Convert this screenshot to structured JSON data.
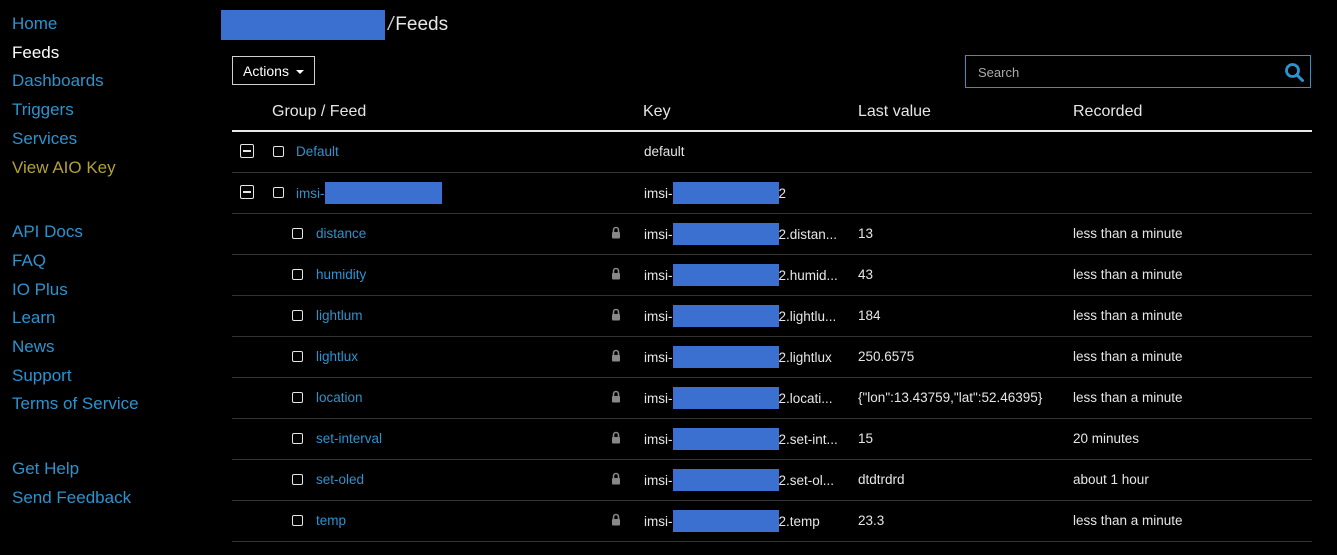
{
  "sidebar": {
    "primary": [
      {
        "label": "Home",
        "name": "sidebar-item-home"
      },
      {
        "label": "Feeds",
        "name": "sidebar-item-feeds"
      },
      {
        "label": "Dashboards",
        "name": "sidebar-item-dashboards"
      },
      {
        "label": "Triggers",
        "name": "sidebar-item-triggers"
      },
      {
        "label": "Services",
        "name": "sidebar-item-services"
      },
      {
        "label": "View AIO Key",
        "name": "sidebar-item-view-aio-key"
      }
    ],
    "secondary": [
      {
        "label": "API Docs"
      },
      {
        "label": "FAQ"
      },
      {
        "label": "IO Plus"
      },
      {
        "label": "Learn"
      },
      {
        "label": "News"
      },
      {
        "label": "Support"
      },
      {
        "label": "Terms of Service"
      }
    ],
    "tertiary": [
      {
        "label": "Get Help"
      },
      {
        "label": "Send Feedback"
      }
    ]
  },
  "breadcrumb": {
    "separator": "/",
    "current": "Feeds"
  },
  "toolbar": {
    "actions_label": "Actions",
    "search_placeholder": "Search"
  },
  "table": {
    "headers": {
      "group_feed": "Group / Feed",
      "key": "Key",
      "last_value": "Last value",
      "recorded": "Recorded"
    },
    "groups": [
      {
        "name": "Default",
        "key": "default"
      },
      {
        "name_prefix": "imsi-",
        "key_prefix": "imsi-",
        "key_suffix": "2"
      }
    ],
    "feeds": [
      {
        "name": "distance",
        "key_prefix": "imsi-",
        "key_suffix": "2.distan...",
        "last_value": "13",
        "recorded": "less than a minute"
      },
      {
        "name": "humidity",
        "key_prefix": "imsi-",
        "key_suffix": "2.humid...",
        "last_value": "43",
        "recorded": "less than a minute"
      },
      {
        "name": "lightlum",
        "key_prefix": "imsi-",
        "key_suffix": "2.lightlu...",
        "last_value": "184",
        "recorded": "less than a minute"
      },
      {
        "name": "lightlux",
        "key_prefix": "imsi-",
        "key_suffix": "2.lightlux",
        "last_value": "250.6575",
        "recorded": "less than a minute"
      },
      {
        "name": "location",
        "key_prefix": "imsi-",
        "key_suffix": "2.locati...",
        "last_value": "{\"lon\":13.43759,\"lat\":52.46395}",
        "recorded": "less than a minute"
      },
      {
        "name": "set-interval",
        "key_prefix": "imsi-",
        "key_suffix": "2.set-int...",
        "last_value": "15",
        "recorded": "20 minutes"
      },
      {
        "name": "set-oled",
        "key_prefix": "imsi-",
        "key_suffix": "2.set-ol...",
        "last_value": "dtdtrdrd",
        "recorded": "about 1 hour"
      },
      {
        "name": "temp",
        "key_prefix": "imsi-",
        "key_suffix": "2.temp",
        "last_value": "23.3",
        "recorded": "less than a minute"
      }
    ]
  },
  "colors": {
    "link": "#2c93cf",
    "aio_key": "#b2a233",
    "redaction": "#3b6fd0",
    "background": "#000000"
  }
}
